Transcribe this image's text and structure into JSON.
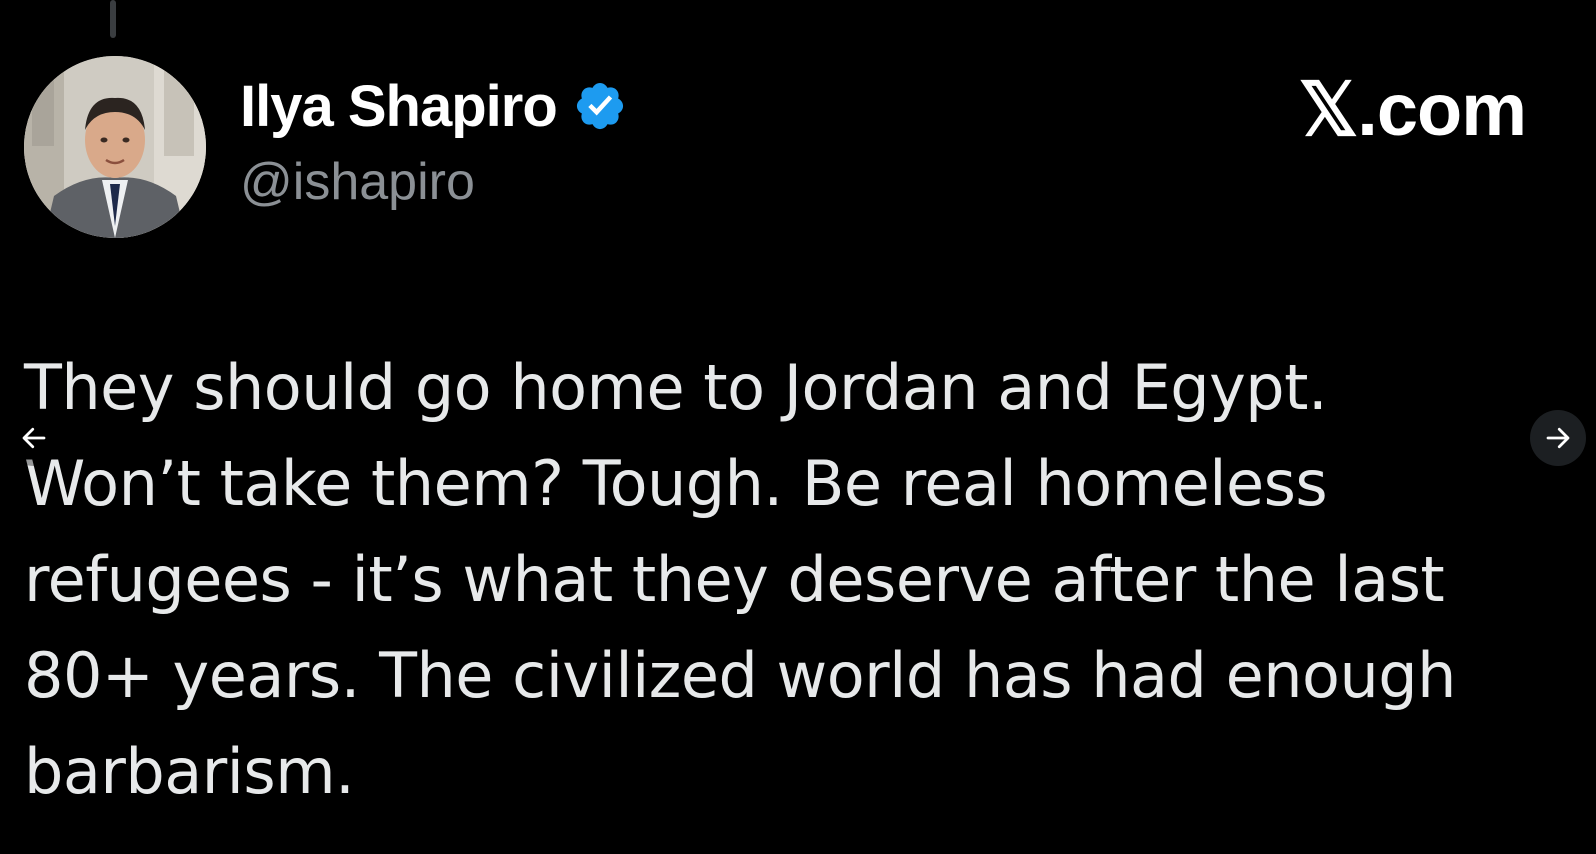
{
  "tweet": {
    "author": {
      "display_name": "Ilya Shapiro",
      "handle": "@ishapiro",
      "verified": true,
      "verified_icon": "verified-badge-icon",
      "verified_color": "#1d9bf0"
    },
    "brand": "𝕏.com",
    "text_lines": [
      "They should go home to Jordan and Egypt.",
      "Won’t take them? Tough. Be real homeless",
      "refugees - it’s what they deserve after the last",
      "80+ years. The civilized world has had enough",
      "barbarism."
    ]
  },
  "carousel": {
    "prev_icon": "arrow-left-icon",
    "next_icon": "arrow-right-icon"
  },
  "colors": {
    "background": "#000000",
    "text_primary": "#e7e9ea",
    "text_secondary": "#8b9095",
    "accent": "#1d9bf0"
  }
}
